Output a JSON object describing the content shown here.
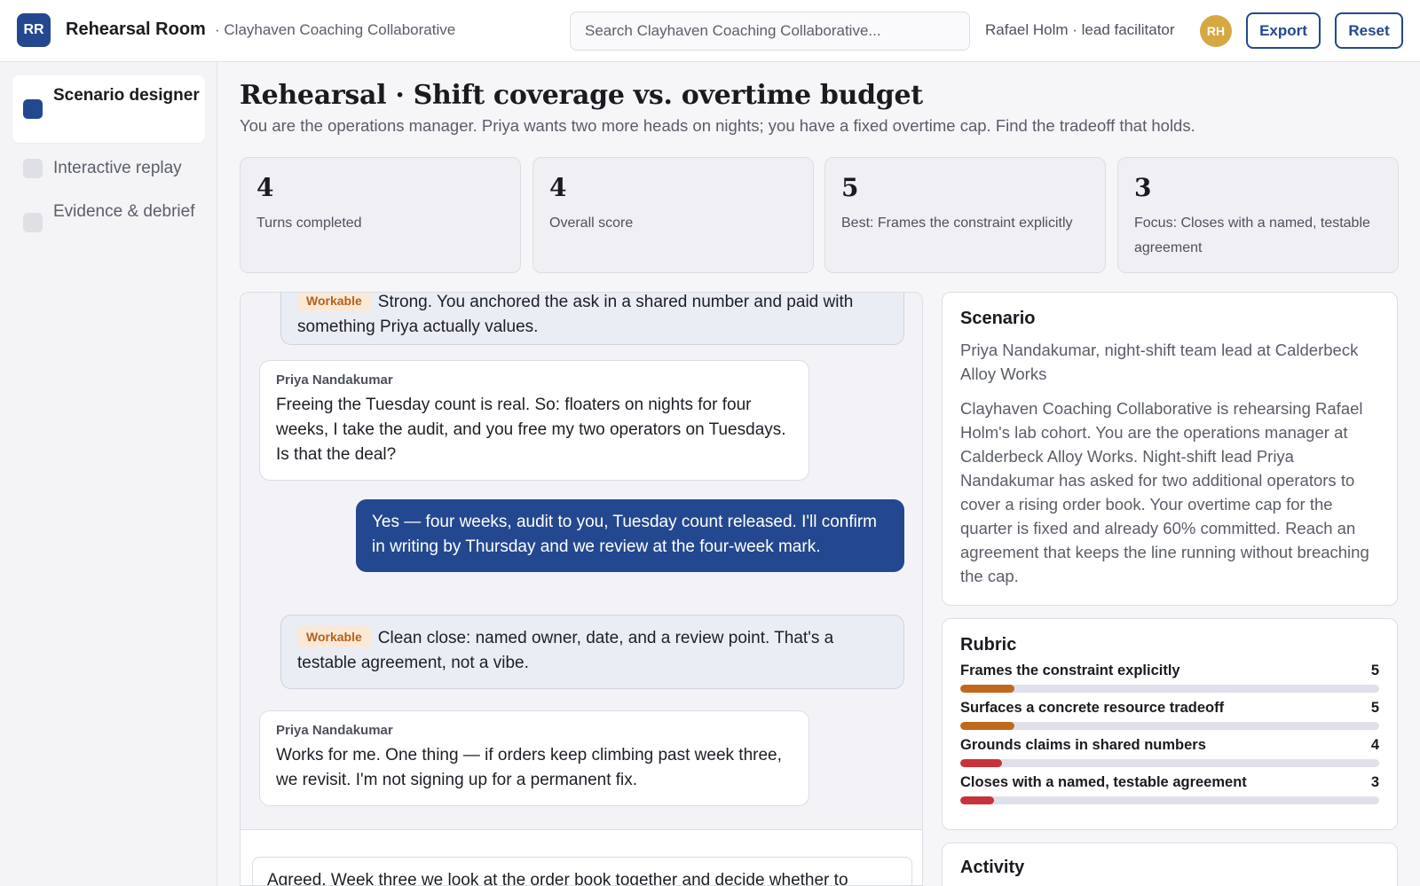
{
  "header": {
    "logo_initials": "RR",
    "app_title": "Rehearsal Room",
    "org_subtitle": "· Clayhaven Coaching Collaborative",
    "search_placeholder": "Search Clayhaven Coaching Collaborative...",
    "user_label": "Rafael Holm · lead facilitator",
    "avatar_initials": "RH",
    "export_label": "Export",
    "reset_label": "Reset"
  },
  "sidebar": {
    "items": [
      {
        "label": "Scenario designer",
        "active": true
      },
      {
        "label": "Interactive replay",
        "active": false
      },
      {
        "label": "Evidence & debrief",
        "active": false
      }
    ]
  },
  "page": {
    "title": "Rehearsal · Shift coverage vs. overtime budget",
    "subtitle": "You are the operations manager. Priya wants two more heads on nights; you have a fixed overtime cap. Find the tradeoff that holds."
  },
  "stats": [
    {
      "value": "4",
      "label": "Turns completed"
    },
    {
      "value": "4",
      "label": "Overall score"
    },
    {
      "value": "5",
      "label": "Best: Frames the constraint explicitly"
    },
    {
      "value": "3",
      "label": "Focus: Closes with a named, testable agreement"
    }
  ],
  "transcript": {
    "messages": [
      {
        "kind": "feedback",
        "tag": "Workable",
        "text": "Strong. You anchored the ask in a shared number and paid with something Priya actually values."
      },
      {
        "kind": "other",
        "speaker": "Priya Nandakumar",
        "text": "Freeing the Tuesday count is real. So: floaters on nights for four weeks, I take the audit, and you free my two operators on Tuesdays. Is that the deal?"
      },
      {
        "kind": "mine",
        "text": "Yes — four weeks, audit to you, Tuesday count released. I'll confirm in writing by Thursday and we review at the four-week mark."
      },
      {
        "kind": "feedback",
        "tag": "Workable",
        "text": "Clean close: named owner, date, and a review point. That's a testable agreement, not a vibe."
      },
      {
        "kind": "other",
        "speaker": "Priya Nandakumar",
        "text": "Works for me. One thing — if orders keep climbing past week three, we revisit. I'm not signing up for a permanent fix."
      }
    ],
    "composer_value": "Agreed. Week three we look at the order book together and decide whether to"
  },
  "scenario": {
    "title": "Scenario",
    "lead": "Priya Nandakumar, night-shift team lead at Calderbeck Alloy Works",
    "body": "Clayhaven Coaching Collaborative is rehearsing Rafael Holm's lab cohort. You are the operations manager at Calderbeck Alloy Works. Night-shift lead Priya Nandakumar has asked for two additional operators to cover a rising order book. Your overtime cap for the quarter is fixed and already 60% committed. Reach an agreement that keeps the line running without breaching the cap."
  },
  "rubric": {
    "title": "Rubric",
    "items": [
      {
        "name": "Frames the constraint explicitly",
        "score": "5",
        "fraction": 0.13,
        "color": "#c0691c"
      },
      {
        "name": "Surfaces a concrete resource tradeoff",
        "score": "5",
        "fraction": 0.13,
        "color": "#c0691c"
      },
      {
        "name": "Grounds claims in shared numbers",
        "score": "4",
        "fraction": 0.1,
        "color": "#c8323a"
      },
      {
        "name": "Closes with a named, testable agreement",
        "score": "3",
        "fraction": 0.08,
        "color": "#c8323a"
      }
    ]
  },
  "activity": {
    "title": "Activity"
  }
}
